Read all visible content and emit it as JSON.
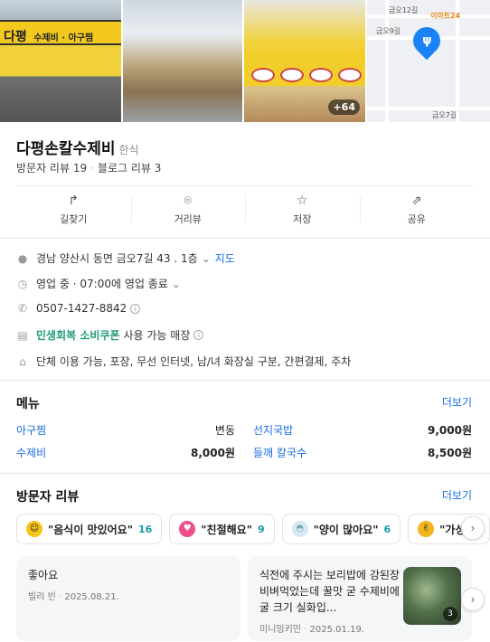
{
  "photos": {
    "sign_name": "다평",
    "sign_text": "수제비 · 아구찜",
    "more_count": "+64"
  },
  "map": {
    "labels": [
      "금오12길",
      "금오9길",
      "금오7길"
    ],
    "brand": "이마트24",
    "pin_icon": "restaurant-icon",
    "accent": "#1a82f7"
  },
  "place": {
    "name": "다평손칼수제비",
    "category": "한식",
    "visitor_reviews": "방문자 리뷰 19",
    "blog_reviews": "블로그 리뷰 3"
  },
  "actions": [
    {
      "label": "길찾기",
      "icon": "directions-icon"
    },
    {
      "label": "거리뷰",
      "icon": "location-pin-icon"
    },
    {
      "label": "저장",
      "icon": "star-icon"
    },
    {
      "label": "공유",
      "icon": "share-icon"
    }
  ],
  "info": {
    "address": "경남 양산시 동면 금오7길 43 . 1층",
    "map_link": "지도",
    "hours": "영업 중 · 07:00에 영업 종료",
    "phone": "0507-1427-8842",
    "coupon_highlight": "민생회복 소비쿠폰",
    "coupon_rest": "사용 가능 매장",
    "amenities": "단체 이용 가능, 포장, 무선 인터넷, 남/녀 화장실 구분, 간편결제, 주차"
  },
  "menu": {
    "title": "메뉴",
    "more": "더보기",
    "items": [
      {
        "name": "아구찜",
        "price": "변동"
      },
      {
        "name": "선지국밥",
        "price": "9,000원"
      },
      {
        "name": "수제비",
        "price": "8,000원"
      },
      {
        "name": "들깨 칼국수",
        "price": "8,500원"
      }
    ]
  },
  "visitor_reviews": {
    "title": "방문자 리뷰",
    "more": "더보기",
    "chips": [
      {
        "text": "\"음식이 맛있어요\"",
        "count": "16",
        "color": "#f5c518"
      },
      {
        "text": "\"친절해요\"",
        "count": "9",
        "color": "#ec4f8c"
      },
      {
        "text": "\"양이 많아요\"",
        "count": "6",
        "color": "#9cc9e6"
      },
      {
        "text": "\"가성",
        "count": "",
        "color": "#f2b51d"
      }
    ],
    "cards": [
      {
        "text": "좋아요",
        "author": "빌리 빈",
        "date": "2025.08.21."
      },
      {
        "text": "식전에 주시는 보리밥에 강된장 비벼먹었는데 꿀맛 굳 수제비에 굴 크기 실화입...",
        "author": "미니밍키민",
        "date": "2025.01.19.",
        "photo_count": "3"
      }
    ]
  }
}
